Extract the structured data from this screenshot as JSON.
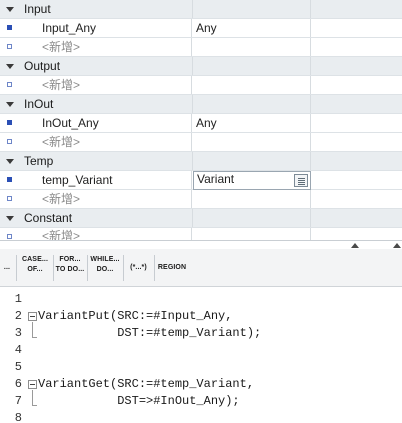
{
  "interface": {
    "sections": [
      {
        "label": "Input",
        "vars": [
          {
            "name": "Input_Any",
            "type": "Any"
          }
        ],
        "add_label": "<新增>"
      },
      {
        "label": "Output",
        "vars": [],
        "add_label": "<新增>"
      },
      {
        "label": "InOut",
        "vars": [
          {
            "name": "InOut_Any",
            "type": "Any"
          }
        ],
        "add_label": "<新增>"
      },
      {
        "label": "Temp",
        "vars": [
          {
            "name": "temp_Variant",
            "type": "Variant"
          }
        ],
        "add_label": "<新增>"
      },
      {
        "label": "Constant",
        "vars": [],
        "add_label": "<新增>"
      }
    ]
  },
  "toolbar": {
    "buttons": [
      {
        "id": "if",
        "lines": [
          "..."
        ]
      },
      {
        "id": "case",
        "lines": [
          "CASE...",
          "OF..."
        ]
      },
      {
        "id": "for",
        "lines": [
          "FOR...",
          "TO DO..."
        ]
      },
      {
        "id": "while",
        "lines": [
          "WHILE...",
          "DO..."
        ]
      },
      {
        "id": "comment",
        "lines": [
          "(*...*)"
        ]
      },
      {
        "id": "region",
        "lines": [
          "REGION"
        ]
      }
    ]
  },
  "editor": {
    "lines": [
      {
        "n": "1",
        "text": ""
      },
      {
        "n": "2",
        "text": "VariantPut(SRC:=#Input_Any,"
      },
      {
        "n": "3",
        "text": "           DST:=#temp_Variant);"
      },
      {
        "n": "4",
        "text": ""
      },
      {
        "n": "5",
        "text": ""
      },
      {
        "n": "6",
        "text": "VariantGet(SRC:=#temp_Variant,"
      },
      {
        "n": "7",
        "text": "           DST=>#InOut_Any);"
      },
      {
        "n": "8",
        "text": ""
      }
    ]
  }
}
